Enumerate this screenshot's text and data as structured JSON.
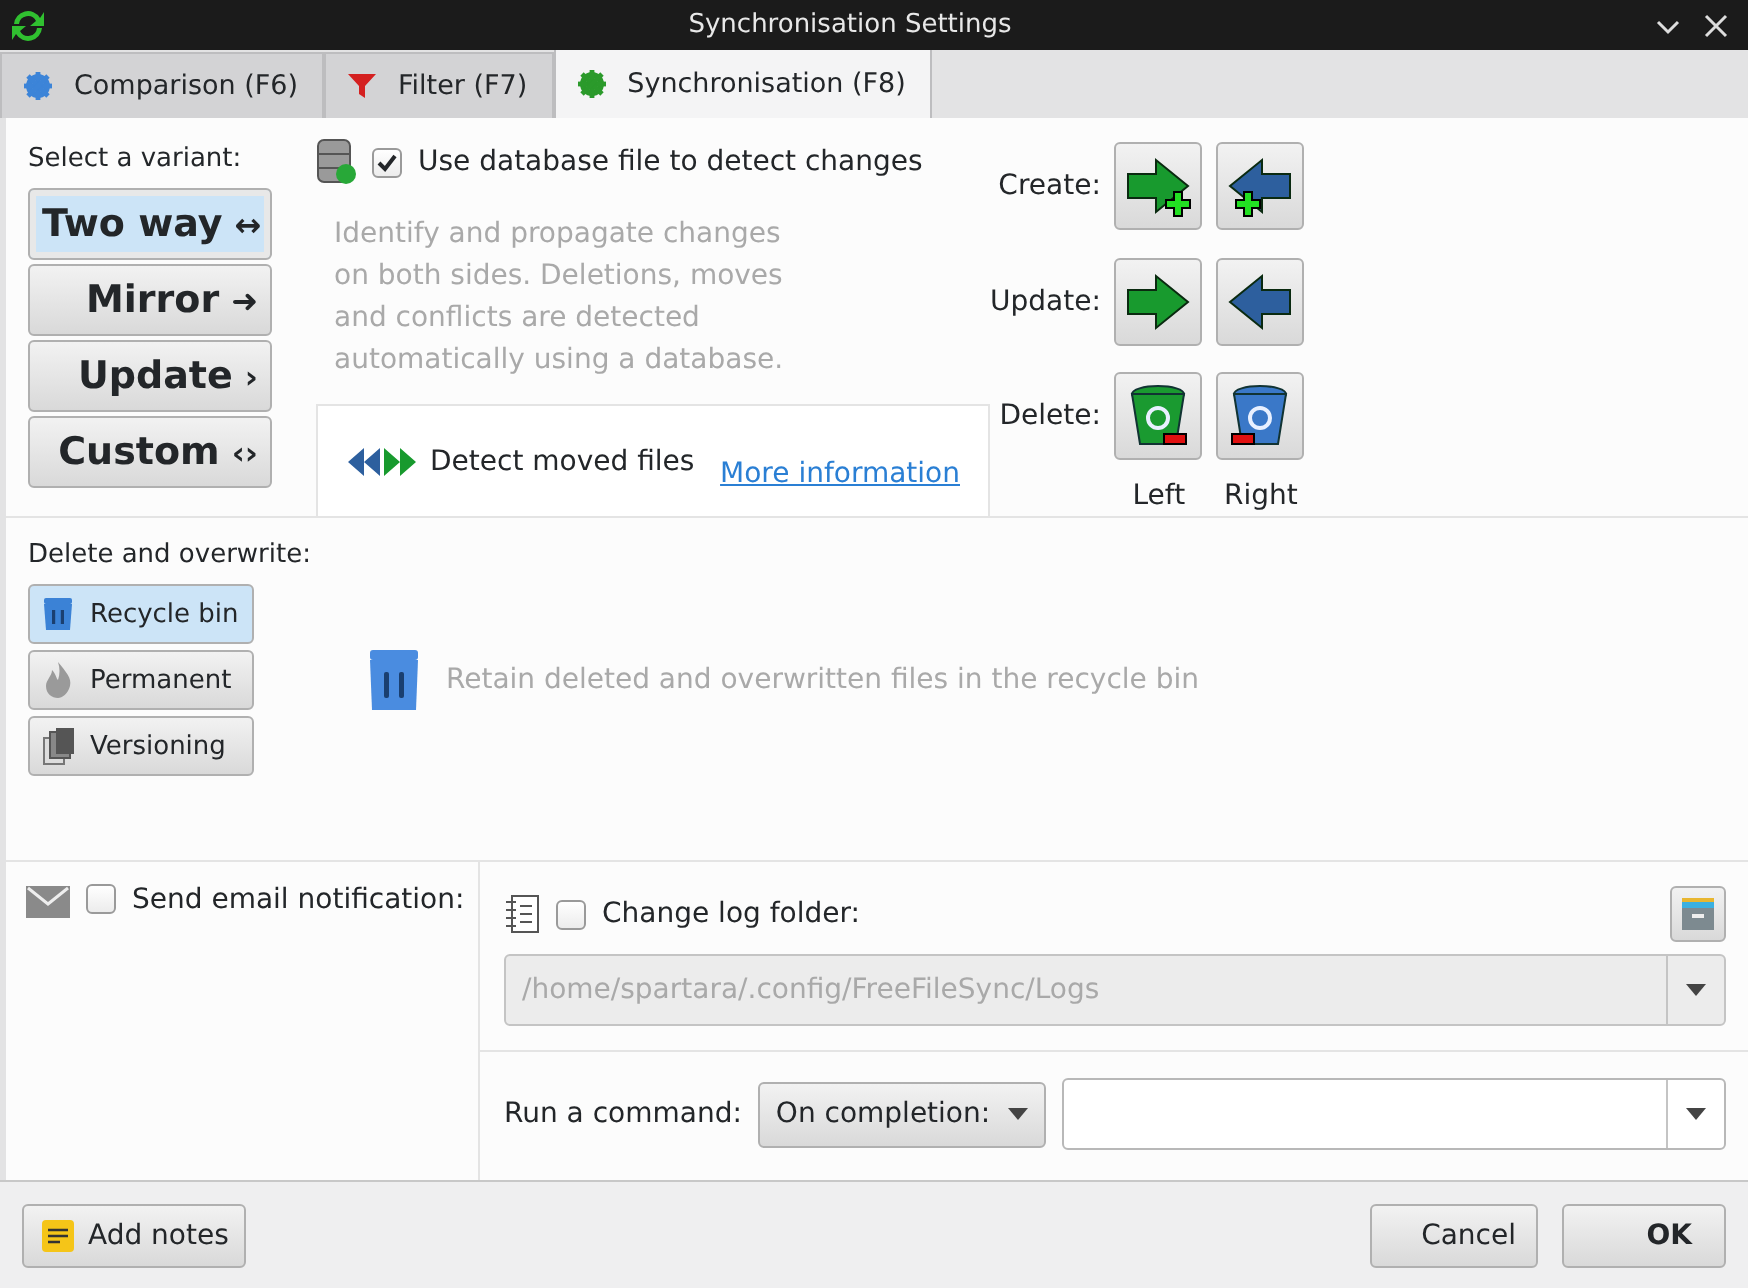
{
  "window": {
    "title": "Synchronisation Settings"
  },
  "tabs": [
    {
      "label": "Comparison (F6)",
      "selected": false
    },
    {
      "label": "Filter (F7)",
      "selected": false
    },
    {
      "label": "Synchronisation (F8)",
      "selected": true
    }
  ],
  "variants": {
    "label": "Select a variant:",
    "options": [
      {
        "label": "Two way",
        "symbol": "↔",
        "selected": true
      },
      {
        "label": "Mirror",
        "symbol": "➜",
        "selected": false
      },
      {
        "label": "Update",
        "symbol": "›",
        "selected": false
      },
      {
        "label": "Custom",
        "symbol": "‹›",
        "selected": false
      }
    ]
  },
  "database": {
    "label": "Use database file to detect changes",
    "checked": true
  },
  "description": "Identify and propagate changes on both sides. Deletions, moves and conflicts are detected automatically using a database.",
  "detect_moved": {
    "label": "Detect moved files",
    "link": "More information"
  },
  "directions": {
    "rows": [
      {
        "label": "Create:"
      },
      {
        "label": "Update:"
      },
      {
        "label": "Delete:"
      }
    ],
    "columns": [
      "Left",
      "Right"
    ]
  },
  "deletion": {
    "label": "Delete and overwrite:",
    "options": [
      {
        "label": "Recycle bin",
        "selected": true
      },
      {
        "label": "Permanent",
        "selected": false
      },
      {
        "label": "Versioning",
        "selected": false
      }
    ],
    "description": "Retain deleted and overwritten files in the recycle bin"
  },
  "email": {
    "label": "Send email notification:",
    "checked": false
  },
  "log_folder": {
    "label": "Change log folder:",
    "checked": false,
    "path": "/home/spartara/.config/FreeFileSync/Logs"
  },
  "command": {
    "label": "Run a command:",
    "trigger": "On completion:"
  },
  "footer": {
    "notes": "Add notes",
    "cancel": "Cancel",
    "ok": "OK"
  }
}
